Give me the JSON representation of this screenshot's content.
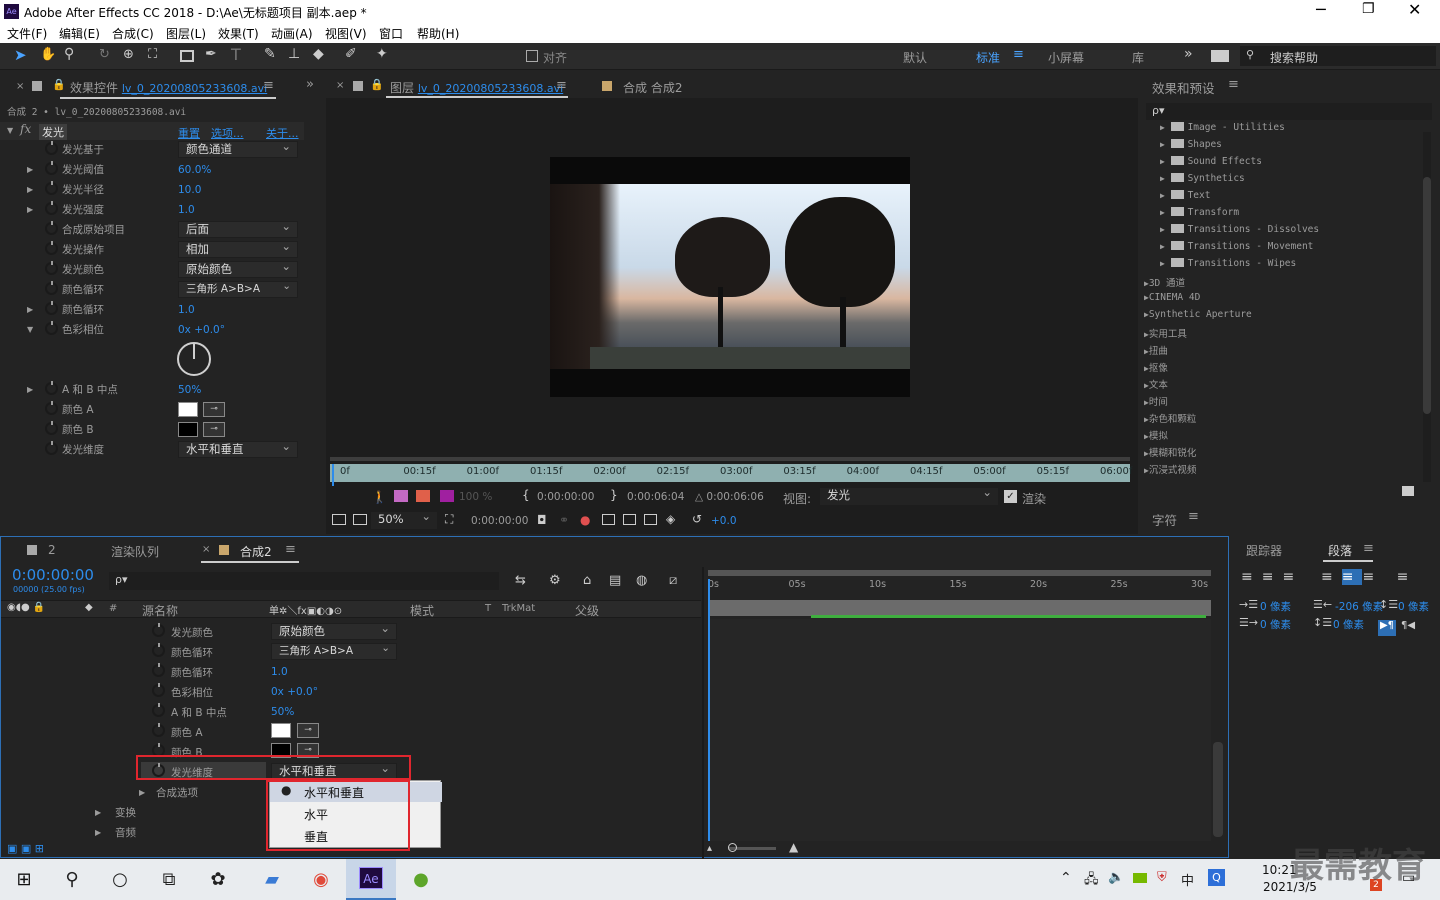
{
  "app": {
    "title": "Adobe After Effects CC 2018 - D:\\Ae\\无标题项目 副本.aep *",
    "icon": "Ae"
  },
  "menu": [
    "文件(F)",
    "编辑(E)",
    "合成(C)",
    "图层(L)",
    "效果(T)",
    "动画(A)",
    "视图(V)",
    "窗口",
    "帮助(H)"
  ],
  "toolbar": {
    "snap": "对齐",
    "workspaces": [
      "默认",
      "标准",
      "小屏幕",
      "库"
    ],
    "search_placeholder": "搜索帮助"
  },
  "effect_controls": {
    "tab_prefix": "效果控件",
    "tab_file": "lv_0_20200805233608.avi",
    "breadcrumb": "合成 2 • lv_0_20200805233608.avi",
    "fx": "fx",
    "effect": "发光",
    "reset": "重置",
    "options": "选项...",
    "about": "关于...",
    "rows": [
      {
        "label": "发光基于",
        "value": "颜色通道",
        "type": "dd"
      },
      {
        "label": "发光阈值",
        "value": "60.0%",
        "type": "num"
      },
      {
        "label": "发光半径",
        "value": "10.0",
        "type": "num"
      },
      {
        "label": "发光强度",
        "value": "1.0",
        "type": "num"
      },
      {
        "label": "合成原始项目",
        "value": "后面",
        "type": "dd"
      },
      {
        "label": "发光操作",
        "value": "相加",
        "type": "dd"
      },
      {
        "label": "发光颜色",
        "value": "原始颜色",
        "type": "dd"
      },
      {
        "label": "颜色循环",
        "value": "三角形 A>B>A",
        "type": "dd"
      },
      {
        "label": "颜色循环",
        "value": "1.0",
        "type": "num"
      },
      {
        "label": "色彩相位",
        "value": "0x +0.0°",
        "type": "num"
      }
    ],
    "rows2": [
      {
        "label": "A 和 B 中点",
        "value": "50%",
        "type": "num"
      },
      {
        "label": "颜色 A",
        "value": "#ffffff",
        "type": "color"
      },
      {
        "label": "颜色 B",
        "value": "#000000",
        "type": "color"
      },
      {
        "label": "发光维度",
        "value": "水平和垂直",
        "type": "dd"
      }
    ]
  },
  "layer_panel": {
    "tab_prefix": "图层",
    "tab_file": "lv_0_20200805233608.avi",
    "comp_tab": "合成 合成2",
    "ruler": [
      "0f",
      "00:15f",
      "01:00f",
      "01:15f",
      "02:00f",
      "02:15f",
      "03:00f",
      "03:15f",
      "04:00f",
      "04:15f",
      "05:00f",
      "05:15f",
      "06:00f"
    ],
    "opacity": "100 %",
    "time_in": "0:00:00:00",
    "time_out": "0:00:06:04",
    "duration": "△ 0:00:06:06",
    "view_label": "视图:",
    "view_value": "发光",
    "render": "渲染",
    "zoom": "50%",
    "timecode": "0:00:00:00",
    "exposure": "+0.0"
  },
  "effects_presets": {
    "title": "效果和预设",
    "search_placeholder": "ρ▾",
    "sub_items": [
      "Image - Utilities",
      "Shapes",
      "Sound Effects",
      "Synthetics",
      "Text",
      "Transform",
      "Transitions - Dissolves",
      "Transitions - Movement",
      "Transitions - Wipes"
    ],
    "categories": [
      "3D 通道",
      "CINEMA 4D",
      "Synthetic Aperture",
      "实用工具",
      "扭曲",
      "抠像",
      "文本",
      "时间",
      "杂色和颗粒",
      "模拟",
      "模糊和锐化",
      "沉浸式视频"
    ]
  },
  "character": {
    "title": "字符"
  },
  "timeline": {
    "tabs": [
      "2",
      "渲染队列",
      "合成2"
    ],
    "timecode": "0:00:00:00",
    "fps": "00000 (25.00 fps)",
    "search_placeholder": "ρ▾",
    "col_source": "源名称",
    "col_mode": "模式",
    "col_t": "T",
    "col_trkmat": "TrkMat",
    "col_parent": "父级",
    "ruler": [
      "0s",
      "05s",
      "10s",
      "15s",
      "20s",
      "25s",
      "30s"
    ],
    "rows": [
      {
        "label": "发光颜色",
        "value": "原始颜色",
        "type": "dd"
      },
      {
        "label": "颜色循环",
        "value": "三角形 A>B>A",
        "type": "dd"
      },
      {
        "label": "颜色循环",
        "value": "1.0",
        "type": "num"
      },
      {
        "label": "色彩相位",
        "value": "0x +0.0°",
        "type": "num"
      },
      {
        "label": "A 和 B 中点",
        "value": "50%",
        "type": "num"
      },
      {
        "label": "颜色 A",
        "value": "#ffffff",
        "type": "color"
      },
      {
        "label": "颜色 B",
        "value": "#000000",
        "type": "color"
      },
      {
        "label": "发光维度",
        "value": "水平和垂直",
        "type": "dd"
      }
    ],
    "groups": [
      "合成选项",
      "变换",
      "音频"
    ],
    "dropdown_options": [
      "水平和垂直",
      "水平",
      "垂直"
    ]
  },
  "paragraph": {
    "tabs": [
      "跟踪器",
      "段落"
    ],
    "indent_left": "0 像素",
    "indent_right": "-206 像素",
    "space_before": "0 像素",
    "indent_first": "0 像素",
    "space_after": "0 像素"
  },
  "taskbar": {
    "time": "10:21",
    "date": "2021/3/5",
    "ime": "中",
    "notif": "2"
  },
  "watermark": "最需教育"
}
